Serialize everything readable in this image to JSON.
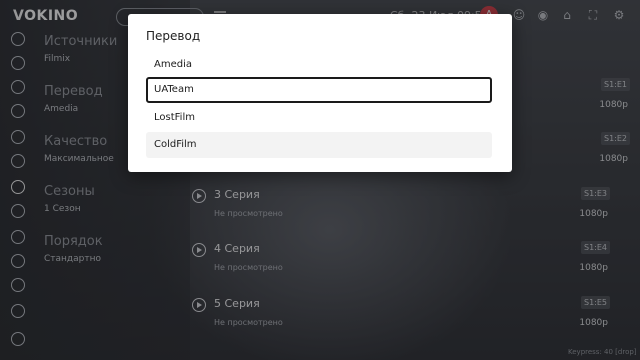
{
  "app": {
    "logo_v": "V",
    "logo_o": "O",
    "logo_rest": "KINO"
  },
  "topbar": {
    "clock": "Сб, 23 Июл 09:55",
    "alert_badge": "A"
  },
  "settings": [
    {
      "label": "Источники",
      "value": "Filmix"
    },
    {
      "label": "Перевод",
      "value": "Amedia"
    },
    {
      "label": "Качество",
      "value": "Максимальное"
    },
    {
      "label": "Сезоны",
      "value": "1 Сезон"
    },
    {
      "label": "Порядок",
      "value": "Стандартно"
    }
  ],
  "episodes": [
    {
      "code": "S1:E1",
      "quality": "1080p"
    },
    {
      "code": "S1:E2",
      "quality": "1080p"
    },
    {
      "title": "3 Серия",
      "status": "Не просмотрено",
      "code": "S1:E3",
      "quality": "1080p"
    },
    {
      "title": "4 Серия",
      "status": "Не просмотрено",
      "code": "S1:E4",
      "quality": "1080p"
    },
    {
      "title": "5 Серия",
      "status": "Не просмотрено",
      "code": "S1:E5",
      "quality": "1080p"
    }
  ],
  "footer": "Keypress: 40 [drop]",
  "modal": {
    "title": "Перевод",
    "options": [
      "Amedia",
      "UATeam",
      "LostFilm",
      "ColdFilm"
    ],
    "selected_index": 1
  }
}
